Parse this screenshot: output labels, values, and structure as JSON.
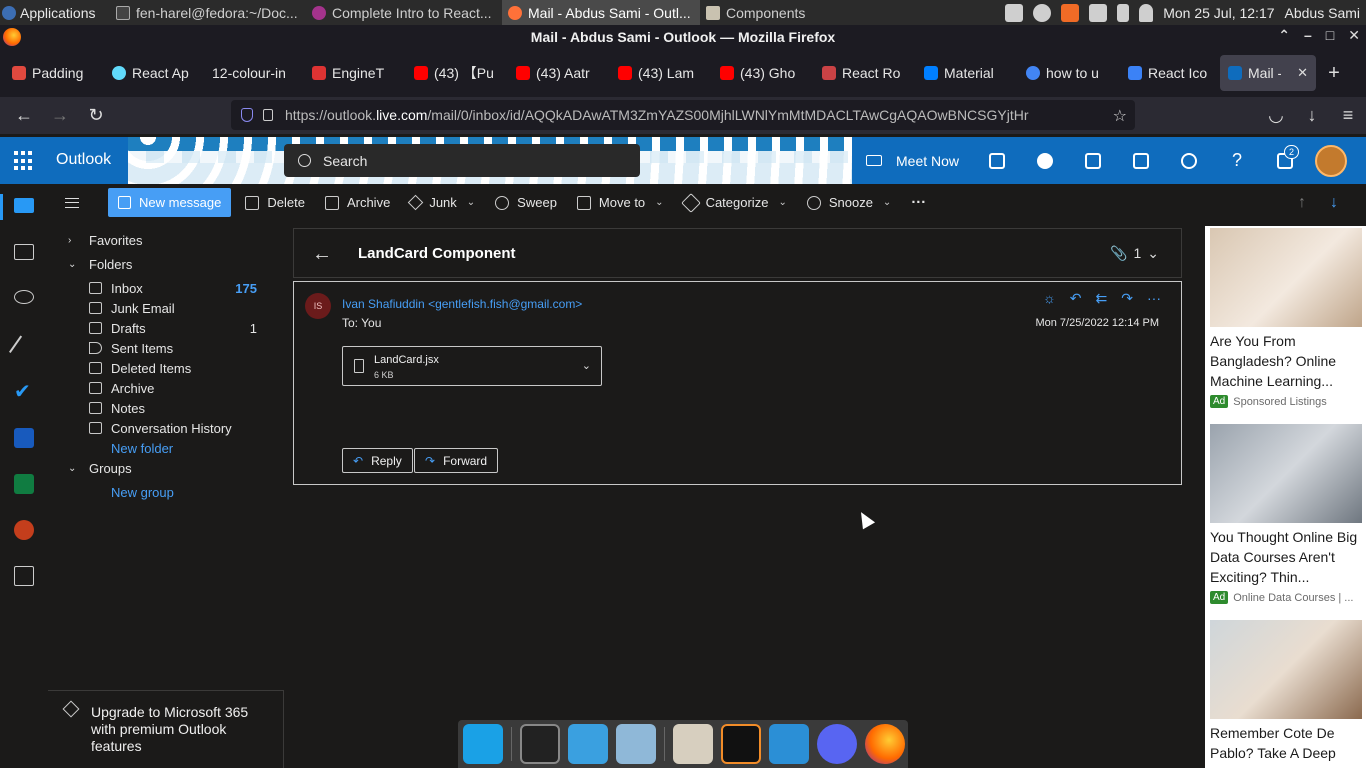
{
  "os": {
    "applications_label": "Applications",
    "tasks": [
      {
        "label": "fen-harel@fedora:~/Doc...",
        "active": false
      },
      {
        "label": "Complete Intro to React...",
        "active": false
      },
      {
        "label": "Mail - Abdus Sami - Outl...",
        "active": true
      },
      {
        "label": "Components",
        "active": false
      }
    ],
    "clock": "Mon 25 Jul, 12:17",
    "user": "Abdus Sami"
  },
  "browser": {
    "window_title": "Mail - Abdus Sami - Outlook — Mozilla Firefox",
    "tabs": [
      {
        "label": "Padding",
        "color": "#e0493f"
      },
      {
        "label": "React Ap",
        "color": "#61dafb"
      },
      {
        "label": "12-colour-in",
        "color": "#888888"
      },
      {
        "label": "EngineT",
        "color": "#d33"
      },
      {
        "label": "(43) 【Pu",
        "color": "#ff0000"
      },
      {
        "label": "(43) Aatr",
        "color": "#ff0000"
      },
      {
        "label": "(43) Lam",
        "color": "#ff0000"
      },
      {
        "label": "(43) Gho",
        "color": "#ff0000"
      },
      {
        "label": "React Ro",
        "color": "#ca4245"
      },
      {
        "label": "Material",
        "color": "#007fff"
      },
      {
        "label": "how to u",
        "color": "#4285f4"
      },
      {
        "label": "React Ico",
        "color": "#3b82f6"
      },
      {
        "label": "Mail - A",
        "color": "#0f6cbd",
        "active": true
      }
    ],
    "url_prefix": "https://outlook.",
    "url_domain": "live.com",
    "url_rest": "/mail/0/inbox/id/AQQkADAwATM3ZmYAZS00MjhlLWNlYmMtMDACLTAwCgAQAOwBNCSGYjtHr"
  },
  "outlook": {
    "brand": "Outlook",
    "search_placeholder": "Search",
    "meet_now": "Meet Now",
    "notification_count": "2"
  },
  "commands": {
    "new_message": "New message",
    "delete": "Delete",
    "archive": "Archive",
    "junk": "Junk",
    "sweep": "Sweep",
    "move_to": "Move to",
    "categorize": "Categorize",
    "snooze": "Snooze",
    "more": "···"
  },
  "folders": {
    "favorites": "Favorites",
    "folders_header": "Folders",
    "items": [
      {
        "label": "Inbox",
        "count": "175"
      },
      {
        "label": "Junk Email",
        "count": ""
      },
      {
        "label": "Drafts",
        "count": "1"
      },
      {
        "label": "Sent Items",
        "count": ""
      },
      {
        "label": "Deleted Items",
        "count": ""
      },
      {
        "label": "Archive",
        "count": ""
      },
      {
        "label": "Notes",
        "count": ""
      },
      {
        "label": "Conversation History",
        "count": ""
      }
    ],
    "new_folder": "New folder",
    "groups": "Groups",
    "new_group": "New group",
    "upgrade_text": "Upgrade to Microsoft 365 with premium Outlook features"
  },
  "message": {
    "subject": "LandCard Component",
    "attachment_count": "1",
    "sender_initials": "IS",
    "from": "Ivan Shafiuddin <gentlefish.fish@gmail.com>",
    "to": "To:  You",
    "date": "Mon 7/25/2022 12:14 PM",
    "attachment_name": "LandCard.jsx",
    "attachment_size": "6 KB",
    "reply": "Reply",
    "forward": "Forward"
  },
  "ads": [
    {
      "headline": "Are You From Bangladesh? Online Machine Learning...",
      "tag": "Ad",
      "sponsor": "Sponsored Listings"
    },
    {
      "headline": "You Thought Online Big Data Courses Aren't Exciting? Thin...",
      "tag": "Ad",
      "sponsor": "Online Data Courses | ..."
    },
    {
      "headline": "Remember Cote De Pablo? Take A Deep",
      "tag": "",
      "sponsor": ""
    }
  ]
}
